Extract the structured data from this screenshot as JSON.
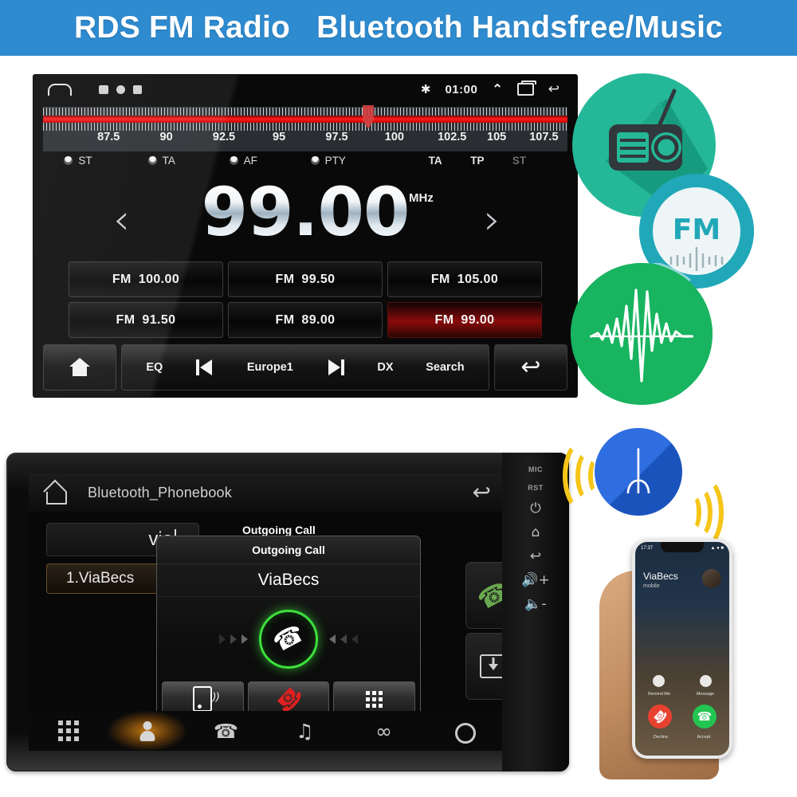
{
  "banner": {
    "text": "RDS FM Radio   Bluetooth Handsfree/Music",
    "bg_color": "#2e8bd0",
    "text_color": "#ffffff"
  },
  "radio": {
    "status_bar": {
      "home_icon": "home-icon",
      "tray_icons": [
        "sim-icon",
        "circle-icon",
        "square-icon"
      ],
      "bluetooth_icon": "✱",
      "clock": "01:00",
      "expand_icon": "⌃",
      "recents_icon": "recents-icon",
      "back_icon": "↩"
    },
    "tuner": {
      "band": "FM",
      "tick_labels": [
        "87.5",
        "90",
        "92.5",
        "95",
        "97.5",
        "100",
        "102.5",
        "105",
        "107.5"
      ],
      "tick_positions_pct": [
        12.5,
        23.5,
        34.5,
        45.0,
        56.0,
        67.0,
        78.0,
        86.5,
        95.5
      ],
      "cursor_pct": 62.0,
      "scale_min": 86.0,
      "scale_max": 109.0
    },
    "rds_toggles": [
      {
        "label": "ST",
        "left_pct": 4
      },
      {
        "label": "TA",
        "left_pct": 20
      },
      {
        "label": "AF",
        "left_pct": 35.5
      },
      {
        "label": "PTY",
        "left_pct": 51
      }
    ],
    "rds_status": [
      {
        "label": "TA",
        "left_pct": 73.5,
        "color": "#e4e4e4"
      },
      {
        "label": "TP",
        "left_pct": 81.5,
        "color": "#e4e4e4"
      },
      {
        "label": "ST",
        "left_pct": 89.5,
        "color": "#6e6e6e"
      }
    ],
    "frequency": {
      "value": "99.00",
      "unit": "MHz",
      "prev_icon": "‹",
      "next_icon": "›"
    },
    "presets": [
      {
        "band": "FM",
        "freq": "100.00",
        "active": false
      },
      {
        "band": "FM",
        "freq": "99.50",
        "active": false
      },
      {
        "band": "FM",
        "freq": "105.00",
        "active": false
      },
      {
        "band": "FM",
        "freq": "91.50",
        "active": false
      },
      {
        "band": "FM",
        "freq": "89.00",
        "active": false
      },
      {
        "band": "FM",
        "freq": "99.00",
        "active": true
      }
    ],
    "bottom_bar": {
      "home_label": "home-icon",
      "eq_label": "EQ",
      "prev_label": "prev-track-icon",
      "region_label": "Europe1",
      "next_label": "next-track-icon",
      "dx_label": "DX",
      "search_label": "Search",
      "back_label": "back-icon"
    }
  },
  "badges": [
    {
      "name": "radio-badge",
      "color": "#24b898",
      "label": ""
    },
    {
      "name": "fm-badge",
      "color": "#21a8b8",
      "label": "FM"
    },
    {
      "name": "waveform-badge",
      "color": "#18b460",
      "label": ""
    }
  ],
  "bluetooth": {
    "screen": {
      "home_icon": "home-icon",
      "title": "Bluetooth_Phonebook",
      "back_icon": "↩",
      "search_value": "via",
      "search_placeholder": "",
      "contacts": [
        {
          "index": "1.",
          "name": "ViaBecs",
          "display": "1.ViaBecs",
          "selected": true
        }
      ],
      "outgoing_label": "Outgoing Call"
    },
    "modal": {
      "title": "Outgoing Call",
      "caller": "ViaBecs",
      "dial_icon": "☎",
      "actions": [
        {
          "name": "transfer-to-phone-button",
          "icon": "phone-transfer-icon"
        },
        {
          "name": "hangup-button",
          "icon": "☎"
        },
        {
          "name": "keypad-button",
          "icon": "keypad-icon"
        }
      ]
    },
    "nav": [
      {
        "name": "nav-keypad",
        "icon": "keypad-icon",
        "active": false
      },
      {
        "name": "nav-contacts",
        "icon": "person-icon",
        "active": true
      },
      {
        "name": "nav-call-log",
        "icon": "✆",
        "active": false
      },
      {
        "name": "nav-music",
        "icon": "♫",
        "active": false
      },
      {
        "name": "nav-pair",
        "icon": "link-icon",
        "active": false
      },
      {
        "name": "nav-settings",
        "icon": "gear-icon",
        "active": false
      }
    ],
    "hardware": {
      "side_labels": [
        "MIC",
        "RST"
      ],
      "side_icons": [
        "⏻",
        "⌂",
        "↩",
        "◂+",
        "◂-"
      ],
      "call_button": "green-handset-icon",
      "save_button": "download-icon"
    }
  },
  "bt_logo": {
    "name": "bluetooth-logo",
    "glyph": "ᛦ",
    "color": "#2f6ee0",
    "wave_color": "#f5c518"
  },
  "phone": {
    "status_time": "17:37",
    "caller_name": "ViaBecs",
    "caller_sub": "mobile",
    "remind_label": "Remind Me",
    "message_label": "Message",
    "decline_label": "Decline",
    "accept_label": "Accept",
    "decline_icon": "☎",
    "accept_icon": "☎"
  }
}
